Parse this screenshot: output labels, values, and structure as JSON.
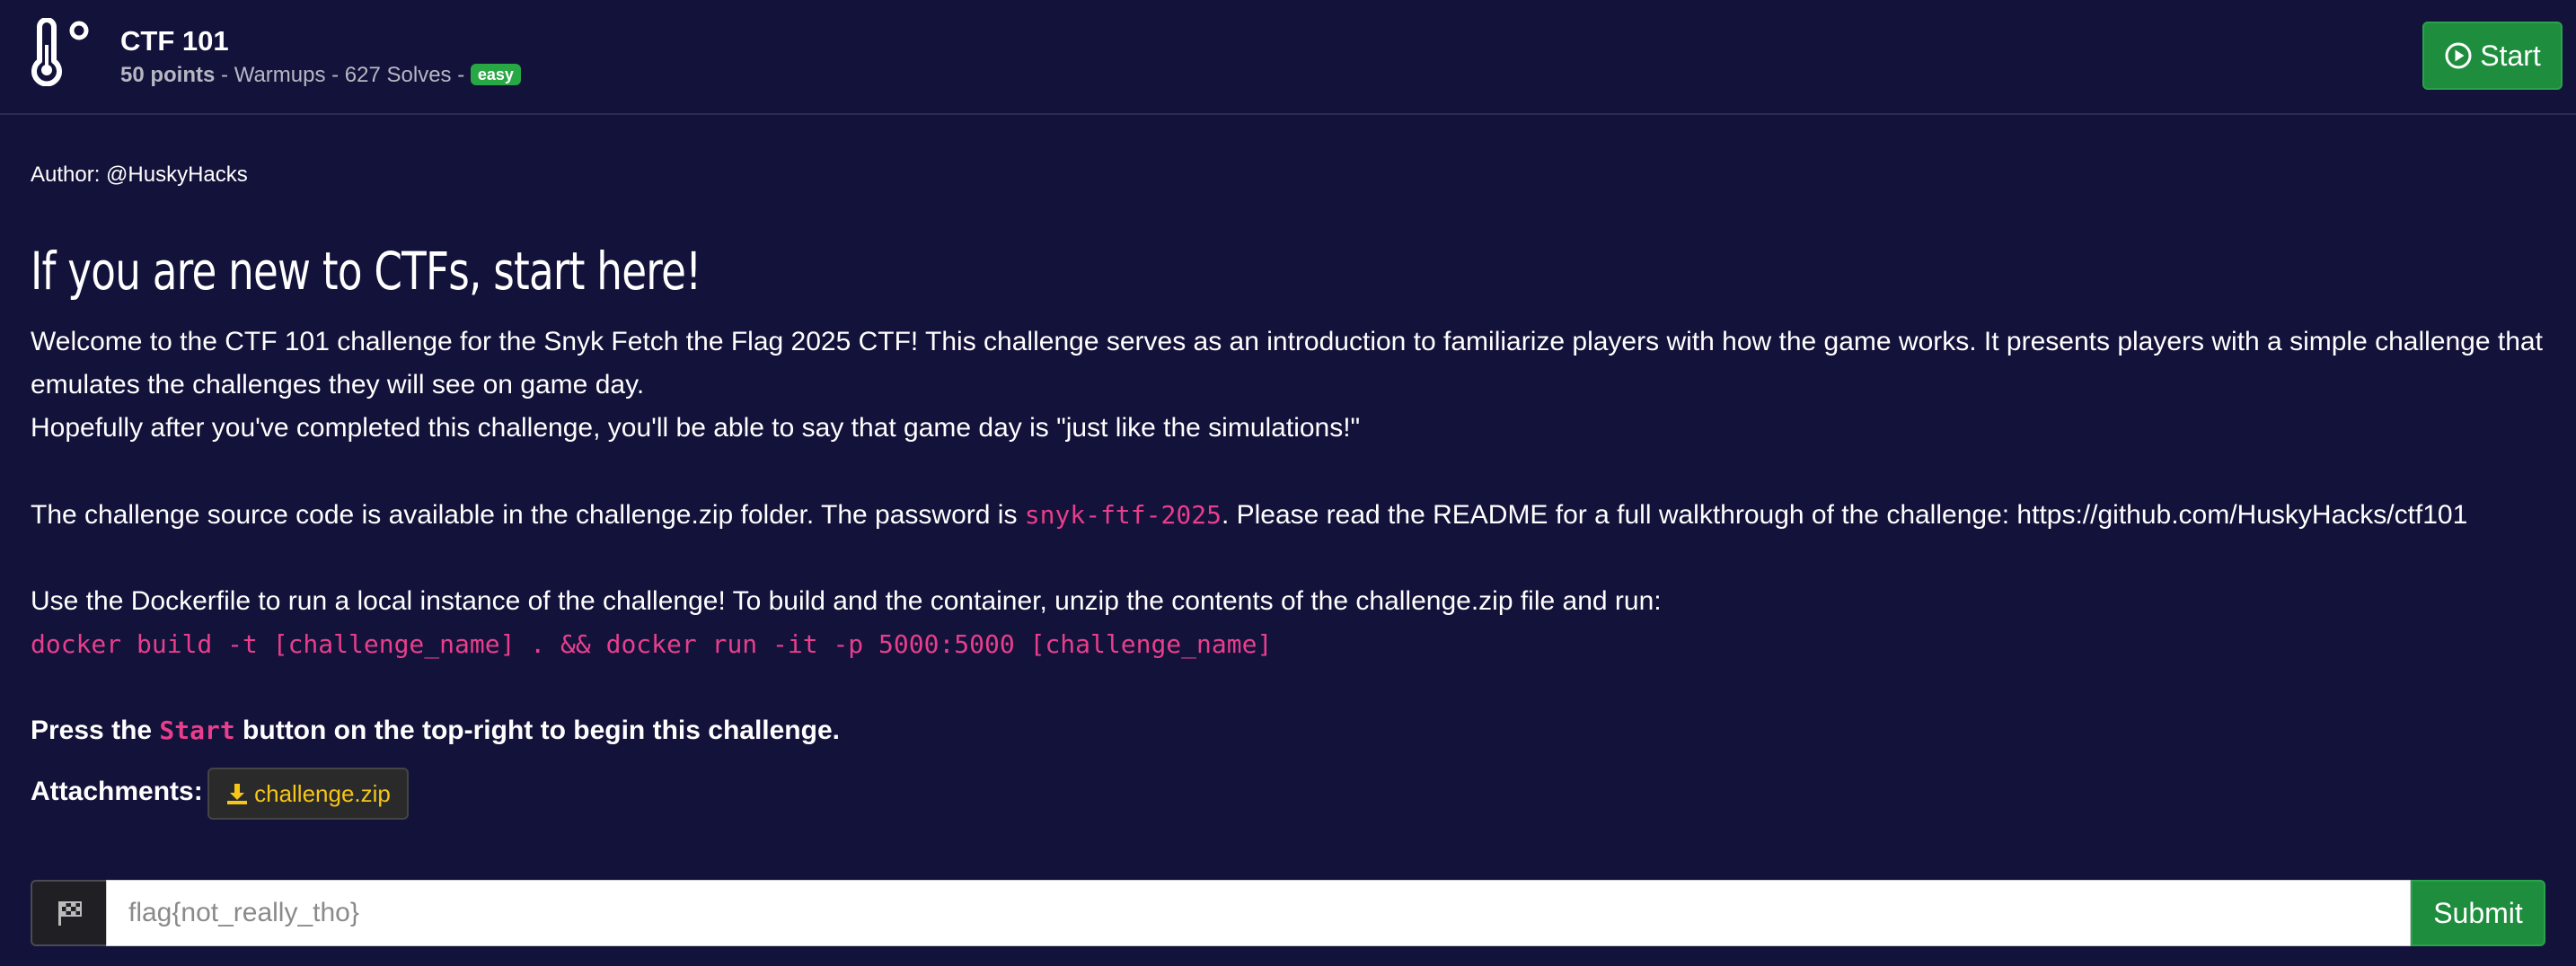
{
  "challenge": {
    "title": "CTF 101",
    "points": "50 points",
    "meta_rest": " - Warmups - 627 Solves - ",
    "difficulty": "easy",
    "start_label": "Start",
    "icon": "thermometer-icon"
  },
  "body": {
    "author": "Author: @HuskyHacks",
    "heading": "If you are new to CTFs, start here!",
    "intro_line1": "Welcome to the CTF 101 challenge for the Snyk Fetch the Flag 2025 CTF! This challenge serves as an introduction to familiarize players with how the game works. It presents players with a simple challenge that",
    "intro_line2": "emulates the challenges they will see on game day.",
    "intro_line3": "Hopefully after you've completed this challenge, you'll be able to say that game day is \"just like the simulations!\"",
    "source_pre": "The challenge source code is available in the challenge.zip folder. The password is ",
    "password": "snyk-ftf-2025",
    "source_post": ". Please read the README for a full walkthrough of the challenge: https://github.com/HuskyHacks/ctf101",
    "docker_line": "Use the Dockerfile to run a local instance of the challenge! To build and the container, unzip the contents of the challenge.zip file and run:",
    "docker_cmd": "docker build -t [challenge_name] . && docker run -it -p 5000:5000 [challenge_name]",
    "press_pre": "Press the ",
    "press_code": "Start",
    "press_post": " button on the top-right to begin this challenge."
  },
  "attachments": {
    "label": "Attachments:",
    "file": "challenge.zip"
  },
  "flag_form": {
    "placeholder": "flag{not_really_tho}",
    "submit_label": "Submit"
  },
  "colors": {
    "background": "#13123a",
    "accent_green": "#1e8e3e",
    "code_pink": "#e83e8c",
    "attachment_yellow": "#f5c518"
  }
}
